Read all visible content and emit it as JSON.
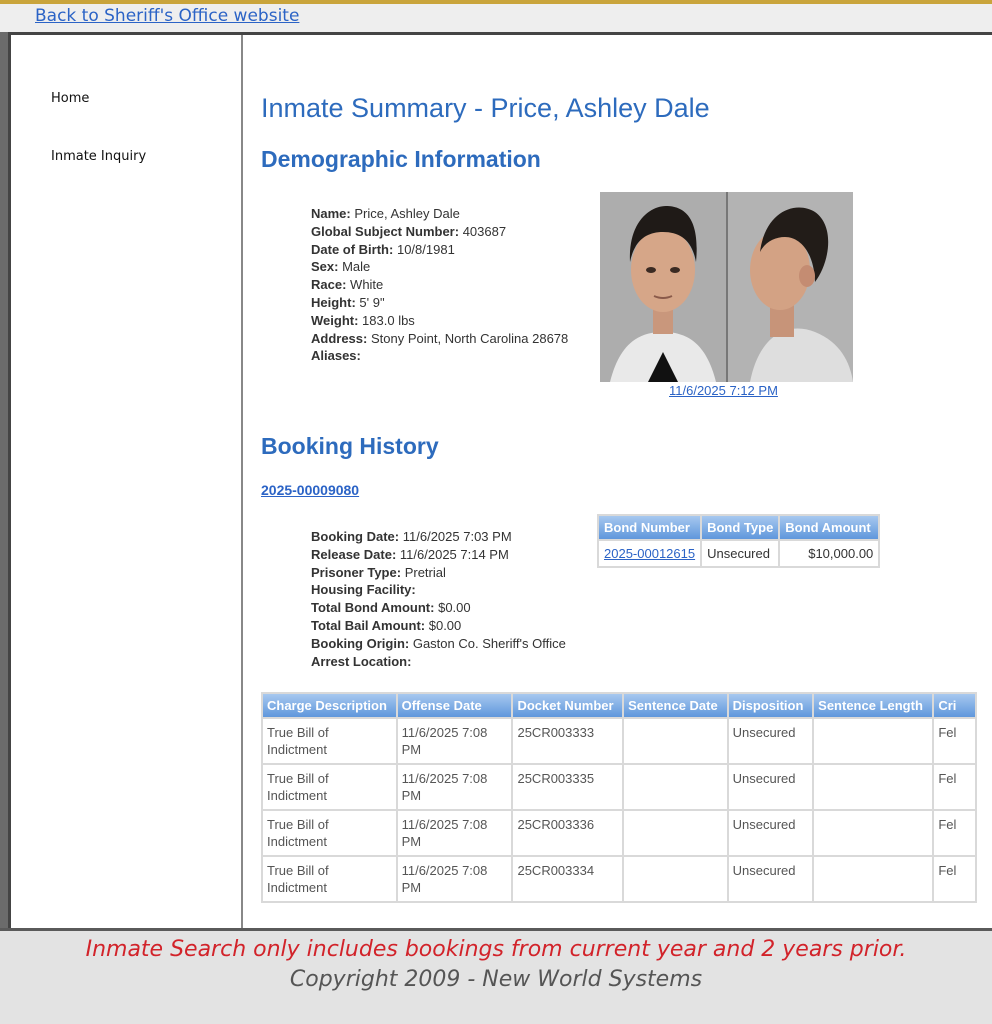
{
  "topbar": {
    "back_link": "Back to Sheriff's Office website"
  },
  "sidebar": {
    "items": [
      {
        "label": "Home"
      },
      {
        "label": "Inmate Inquiry"
      }
    ]
  },
  "page_title": "Inmate Summary - Price, Ashley Dale",
  "demographics": {
    "heading": "Demographic Information",
    "fields": [
      {
        "label": "Name:",
        "value": "Price, Ashley Dale"
      },
      {
        "label": "Global Subject Number:",
        "value": "403687"
      },
      {
        "label": "Date of Birth:",
        "value": "10/8/1981"
      },
      {
        "label": "Sex:",
        "value": "Male"
      },
      {
        "label": "Race:",
        "value": "White"
      },
      {
        "label": "Height:",
        "value": "5' 9\""
      },
      {
        "label": "Weight:",
        "value": "183.0 lbs"
      },
      {
        "label": "Address:",
        "value": "Stony Point, North Carolina 28678"
      },
      {
        "label": "Aliases:",
        "value": ""
      }
    ],
    "photo_caption": "11/6/2025 7:12 PM"
  },
  "booking": {
    "heading": "Booking History",
    "booking_number": "2025-00009080",
    "fields": [
      {
        "label": "Booking Date:",
        "value": "11/6/2025 7:03 PM"
      },
      {
        "label": "Release Date:",
        "value": "11/6/2025 7:14 PM"
      },
      {
        "label": "Prisoner Type:",
        "value": "Pretrial"
      },
      {
        "label": "Housing Facility:",
        "value": ""
      },
      {
        "label": "Total Bond Amount:",
        "value": "$0.00"
      },
      {
        "label": "Total Bail Amount:",
        "value": "$0.00"
      },
      {
        "label": "Booking Origin:",
        "value": "Gaston Co. Sheriff's Office"
      },
      {
        "label": "Arrest Location:",
        "value": ""
      }
    ],
    "bond_table": {
      "headers": [
        "Bond Number",
        "Bond Type",
        "Bond Amount"
      ],
      "rows": [
        [
          "2025-00012615",
          "Unsecured",
          "$10,000.00"
        ]
      ]
    },
    "charges_table": {
      "headers": [
        "Charge Description",
        "Offense Date",
        "Docket Number",
        "Sentence Date",
        "Disposition",
        "Sentence Length",
        "Cri"
      ],
      "rows": [
        [
          "True Bill of Indictment",
          "11/6/2025 7:08 PM",
          "25CR003333",
          "",
          "Unsecured",
          "",
          "Fel"
        ],
        [
          "True Bill of Indictment",
          "11/6/2025 7:08 PM",
          "25CR003335",
          "",
          "Unsecured",
          "",
          "Fel"
        ],
        [
          "True Bill of Indictment",
          "11/6/2025 7:08 PM",
          "25CR003336",
          "",
          "Unsecured",
          "",
          "Fel"
        ],
        [
          "True Bill of Indictment",
          "11/6/2025 7:08 PM",
          "25CR003334",
          "",
          "Unsecured",
          "",
          "Fel"
        ]
      ]
    }
  },
  "footer": {
    "notice": "Inmate Search only includes bookings from current year and 2 years prior.",
    "copyright": "Copyright 2009 - New World Systems"
  },
  "colors": {
    "heading": "#2d6bbd",
    "link": "#2b63c6",
    "notice": "#d2232a",
    "gold_bar": "#c9a43b"
  }
}
